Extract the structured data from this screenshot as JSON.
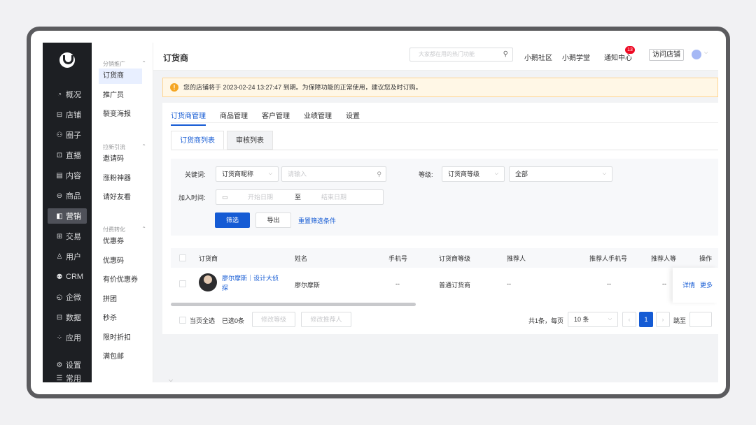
{
  "app": {
    "title": "订货商"
  },
  "nav": {
    "items": [
      {
        "label": "概况",
        "icon": "◔"
      },
      {
        "label": "店铺",
        "icon": "⊟"
      },
      {
        "label": "圈子",
        "icon": "⚇"
      },
      {
        "label": "直播",
        "icon": "⊡"
      },
      {
        "label": "内容",
        "icon": "▤"
      },
      {
        "label": "商品",
        "icon": "⊖"
      },
      {
        "label": "营销",
        "icon": "◧"
      },
      {
        "label": "交易",
        "icon": "⊞"
      },
      {
        "label": "用户",
        "icon": "♙"
      },
      {
        "label": "CRM",
        "icon": "⚉"
      },
      {
        "label": "企微",
        "icon": "◵"
      },
      {
        "label": "数据",
        "icon": "⊟"
      },
      {
        "label": "应用",
        "icon": "⁘"
      },
      {
        "label": "设置",
        "icon": "⚙"
      },
      {
        "label": "常用",
        "icon": "☰"
      }
    ],
    "active": "营销"
  },
  "subnav": {
    "groups": [
      {
        "label": "分销推广",
        "items": [
          "订货商",
          "推广员",
          "裂变海报"
        ]
      },
      {
        "label": "拉新引流",
        "items": [
          "邀请码",
          "涨粉神器",
          "请好友看"
        ]
      },
      {
        "label": "付费转化",
        "items": [
          "优惠券",
          "优惠码",
          "有价优惠券",
          "拼团",
          "秒杀",
          "限时折扣",
          "满包邮"
        ]
      }
    ],
    "active": "订货商"
  },
  "topbar": {
    "search_placeholder": "大家都在用的热门功能",
    "links": [
      "小鹅社区",
      "小鹅学堂",
      "通知中心"
    ],
    "badge": "13",
    "visit_label": "访问店铺"
  },
  "notice": {
    "text": "您的店铺将于 2023-02-24 13:27:47 到期。为保障功能的正常使用，建议您及时订购。"
  },
  "tabs": [
    "订货商管理",
    "商品管理",
    "客户管理",
    "业绩管理",
    "设置"
  ],
  "subtabs": [
    "订货商列表",
    "审核列表"
  ],
  "filter": {
    "keyword_label": "关键词:",
    "keyword_type": "订货商昵称",
    "keyword_placeholder": "请输入",
    "level_label": "等级:",
    "level_type": "订货商等级",
    "level_value": "全部",
    "join_label": "加入时间:",
    "start_placeholder": "开始日期",
    "to": "至",
    "end_placeholder": "结束日期",
    "filter_btn": "筛选",
    "export_btn": "导出",
    "reset_link": "重置筛选条件"
  },
  "table": {
    "headers": [
      "订货商",
      "姓名",
      "手机号",
      "订货商等级",
      "推荐人",
      "推荐人手机号",
      "推荐人等",
      "操作"
    ],
    "rows": [
      {
        "name": "廖尔摩斯｜设计大侦",
        "name2": "探",
        "real_name": "廖尔摩斯",
        "phone": "--",
        "level": "普通订货商",
        "referrer": "--",
        "ref_phone": "--",
        "ref_level": "--",
        "act1": "详情",
        "act2": "更多"
      }
    ]
  },
  "footer": {
    "select_all": "当页全选",
    "selected": "已选0条",
    "btn_level": "修改等级",
    "btn_ref": "修改推荐人",
    "total": "共1条，每页",
    "page_size": "10 条",
    "current_page": "1",
    "jump": "跳至"
  }
}
